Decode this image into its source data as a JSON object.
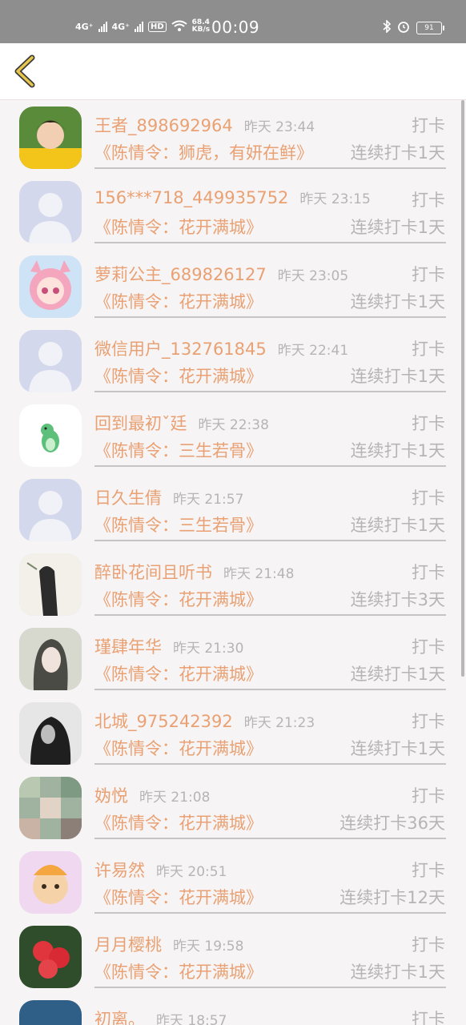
{
  "status_bar": {
    "network1": "4G⁺",
    "network2": "4G⁺",
    "hd": "HD",
    "speed": "68.4",
    "speed_unit": "KB/s",
    "time": "00:09",
    "battery": "91"
  },
  "nav": {
    "back_icon": "chevron-left-icon",
    "accent": "#e7c64b"
  },
  "records": [
    {
      "name": "王者_898692964",
      "time": "昨天 23:44",
      "type": "打卡",
      "song": "《陈情令：狮虎，有妍在鲜》",
      "streak": "连续打卡1天",
      "avatar": "photo"
    },
    {
      "name": "156***718_449935752",
      "time": "昨天 23:15",
      "type": "打卡",
      "song": "《陈情令：花开满城》",
      "streak": "连续打卡1天",
      "avatar": "default"
    },
    {
      "name": "萝莉公主_689826127",
      "time": "昨天 23:05",
      "type": "打卡",
      "song": "《陈情令：花开满城》",
      "streak": "连续打卡1天",
      "avatar": "anime"
    },
    {
      "name": "微信用户_132761845",
      "time": "昨天 22:41",
      "type": "打卡",
      "song": "《陈情令：花开满城》",
      "streak": "连续打卡1天",
      "avatar": "default"
    },
    {
      "name": "回到最初ˇ廷",
      "time": "昨天 22:38",
      "type": "打卡",
      "song": "《陈情令：三生若骨》",
      "streak": "连续打卡1天",
      "avatar": "dino"
    },
    {
      "name": "日久生倩",
      "time": "昨天 21:57",
      "type": "打卡",
      "song": "《陈情令：三生若骨》",
      "streak": "连续打卡1天",
      "avatar": "default"
    },
    {
      "name": "醉卧花间且听书",
      "time": "昨天 21:48",
      "type": "打卡",
      "song": "《陈情令：花开满城》",
      "streak": "连续打卡3天",
      "avatar": "ink"
    },
    {
      "name": "瑾肆年华",
      "time": "昨天 21:30",
      "type": "打卡",
      "song": "《陈情令：花开满城》",
      "streak": "连续打卡1天",
      "avatar": "girl"
    },
    {
      "name": "北城_975242392",
      "time": "昨天 21:23",
      "type": "打卡",
      "song": "《陈情令：花开满城》",
      "streak": "连续打卡1天",
      "avatar": "dark"
    },
    {
      "name": "妫悦",
      "time": "昨天 21:08",
      "type": "打卡",
      "song": "《陈情令：花开满城》",
      "streak": "连续打卡36天",
      "avatar": "mosaic"
    },
    {
      "name": "许易然",
      "time": "昨天 20:51",
      "type": "打卡",
      "song": "《陈情令：花开满城》",
      "streak": "连续打卡12天",
      "avatar": "cartoon"
    },
    {
      "name": "月月樱桃",
      "time": "昨天 19:58",
      "type": "打卡",
      "song": "《陈情令：花开满城》",
      "streak": "连续打卡1天",
      "avatar": "flower"
    },
    {
      "name": "初离。",
      "time": "昨天 18:57",
      "type": "打卡",
      "song": "",
      "streak": "",
      "avatar": "sea"
    }
  ]
}
